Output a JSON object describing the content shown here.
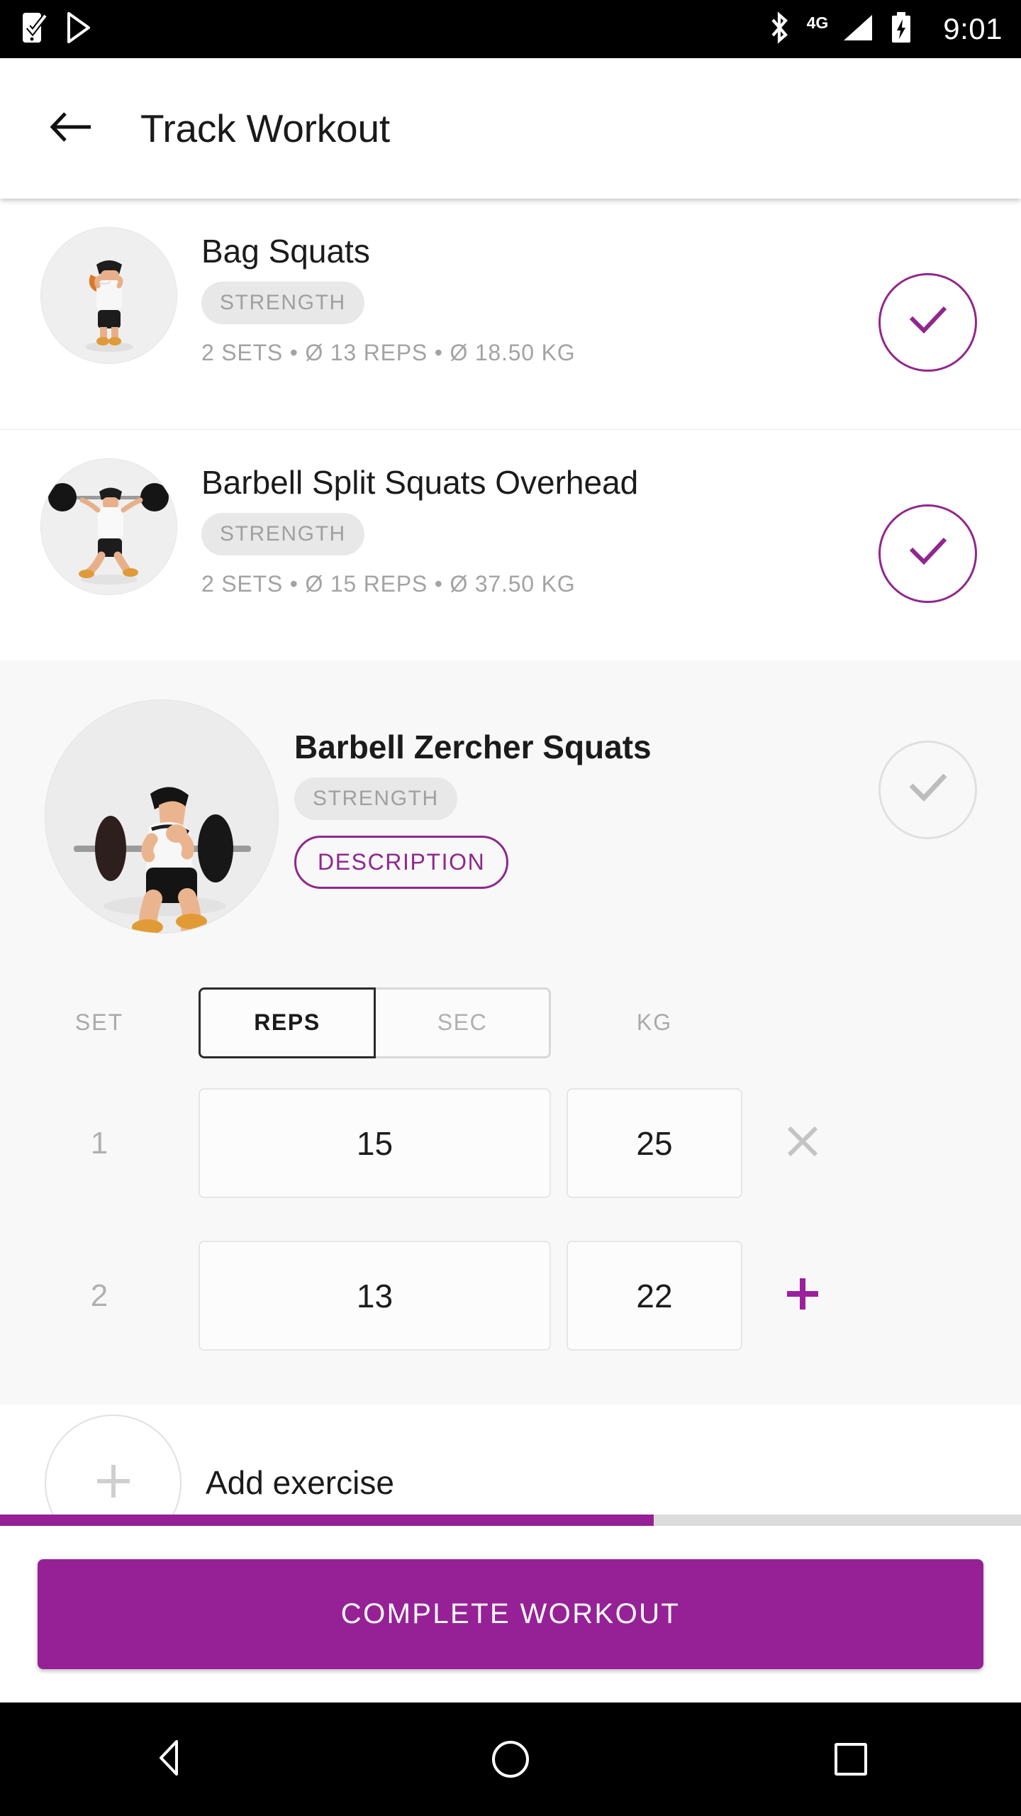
{
  "statusbar": {
    "time": "9:01",
    "network_label": "4G",
    "icons": [
      "task-check-icon",
      "play-store-icon",
      "bluetooth-icon",
      "signal-icon",
      "battery-charging-icon"
    ]
  },
  "appbar": {
    "title": "Track Workout",
    "back_icon": "arrow-left-icon"
  },
  "colors": {
    "accent": "#90278e",
    "accent_button": "#962197",
    "muted_text": "#a3a3a3",
    "badge_bg": "#e8e8e8",
    "card_bg": "#f8f8f8",
    "progress_track": "#dcdcdc"
  },
  "exercises": [
    {
      "name": "Bag Squats",
      "category": "STRENGTH",
      "summary": "2 SETS • Ø 13 REPS  • Ø 18.50 KG",
      "completed": true,
      "thumb": "bag-squats-figure"
    },
    {
      "name": "Barbell Split Squats Overhead",
      "category": "STRENGTH",
      "summary": "2 SETS • Ø 15 REPS  • Ø 37.50 KG",
      "completed": true,
      "thumb": "barbell-split-squats-figure"
    }
  ],
  "active_exercise": {
    "name": "Barbell Zercher Squats",
    "category": "STRENGTH",
    "description_button": "DESCRIPTION",
    "completed": false,
    "thumb": "barbell-zercher-squats-figure",
    "table": {
      "col_set": "SET",
      "col_kg": "KG",
      "unit_toggle": {
        "selected": "REPS",
        "options": [
          "REPS",
          "SEC"
        ]
      },
      "rows": [
        {
          "set": "1",
          "reps": "15",
          "kg": "25",
          "action": "remove"
        },
        {
          "set": "2",
          "reps": "13",
          "kg": "22",
          "action": "add"
        }
      ]
    }
  },
  "add_exercise": {
    "label": "Add exercise",
    "icon": "plus-icon"
  },
  "progress": {
    "percent": 64
  },
  "bottom": {
    "complete_label": "COMPLETE WORKOUT"
  },
  "navbar": {
    "back": "nav-back-icon",
    "home": "nav-home-icon",
    "recents": "nav-recents-icon"
  }
}
